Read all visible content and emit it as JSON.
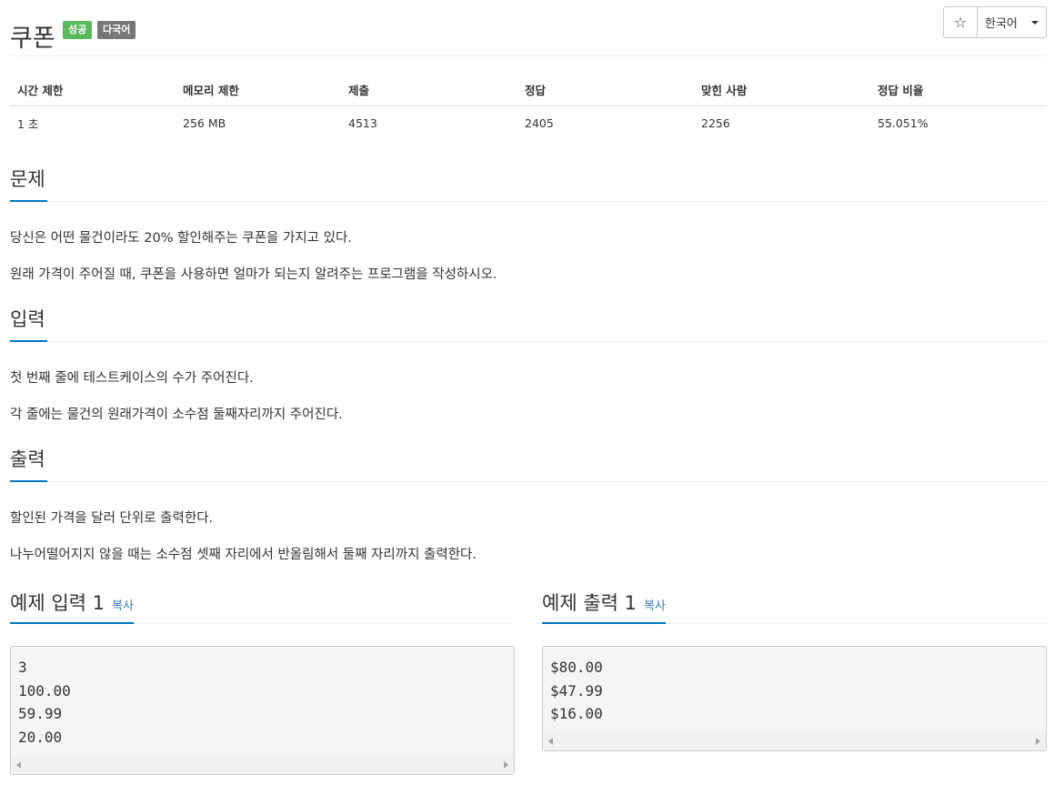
{
  "header": {
    "title": "쿠폰",
    "badge_success": "성공",
    "badge_multilang": "다국어",
    "star_icon": "☆",
    "language_label": "한국어"
  },
  "info_table": {
    "headers": [
      "시간 제한",
      "메모리 제한",
      "제출",
      "정답",
      "맞힌 사람",
      "정답 비율"
    ],
    "values": [
      "1 초",
      "256 MB",
      "4513",
      "2405",
      "2256",
      "55.051%"
    ]
  },
  "problem": {
    "heading": "문제",
    "paragraphs": [
      "당신은 어떤 물건이라도 20% 할인해주는 쿠폰을 가지고 있다.",
      "원래 가격이 주어질 때, 쿠폰을 사용하면 얼마가 되는지 알려주는 프로그램을 작성하시오."
    ]
  },
  "input": {
    "heading": "입력",
    "paragraphs": [
      "첫 번째 줄에 테스트케이스의 수가 주어진다.",
      "각 줄에는 물건의 원래가격이 소수점 둘째자리까지 주어진다."
    ]
  },
  "output": {
    "heading": "출력",
    "paragraphs": [
      "할인된 가격을 달러 단위로 출력한다.",
      "나누어떨어지지 않을 때는 소수점 셋째 자리에서 반올림해서 둘째 자리까지 출력한다."
    ]
  },
  "sample_input": {
    "heading": "예제 입력 1",
    "copy_label": "복사",
    "lines": [
      "3",
      "100.00",
      "59.99",
      "20.00"
    ]
  },
  "sample_output": {
    "heading": "예제 출력 1",
    "copy_label": "복사",
    "lines": [
      "$80.00",
      "$47.99",
      "$16.00"
    ]
  },
  "colors": {
    "success": "#5cb85c",
    "multilang": "#777777",
    "accent": "#0076c0",
    "link": "#337ab7"
  }
}
